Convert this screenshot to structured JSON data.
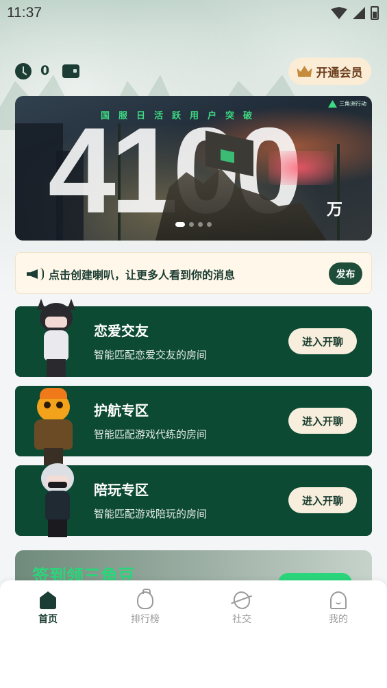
{
  "status_bar": {
    "time": "11:37"
  },
  "top_row": {
    "coin_count": "0",
    "vip_label": "开通会员"
  },
  "banner": {
    "headline": "国服日活跃用户突破",
    "number": "4100",
    "unit": "万",
    "logo_text": "三角洲行动",
    "slide_count": 4,
    "active_slide": 0
  },
  "notice": {
    "text": "点击创建喇叭，让更多人看到你的消息",
    "button_label": "发布"
  },
  "rooms": [
    {
      "title": "恋爱交友",
      "desc": "智能匹配恋爱交友的房间",
      "button_label": "进入开聊"
    },
    {
      "title": "护航专区",
      "desc": "智能匹配游戏代练的房间",
      "button_label": "进入开聊"
    },
    {
      "title": "陪玩专区",
      "desc": "智能匹配游戏陪玩的房间",
      "button_label": "进入开聊"
    }
  ],
  "promo": {
    "title": "签到领三角豆"
  },
  "tabs": [
    {
      "label": "首页",
      "icon": "home-icon",
      "active": true
    },
    {
      "label": "排行榜",
      "icon": "ranking-icon",
      "active": false
    },
    {
      "label": "社交",
      "icon": "social-icon",
      "active": false
    },
    {
      "label": "我的",
      "icon": "profile-icon",
      "active": false
    }
  ],
  "colors": {
    "primary": "#0d4a34",
    "accent": "#3ddc84",
    "vip_bg": "#fbecd5"
  }
}
